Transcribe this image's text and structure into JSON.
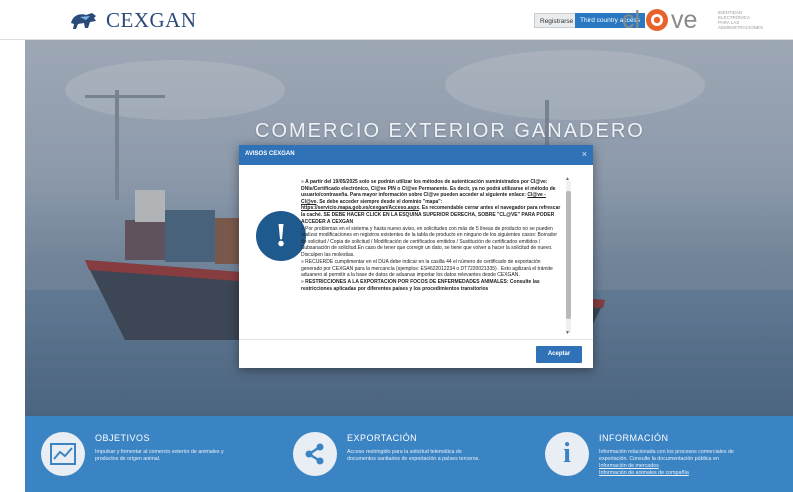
{
  "header": {
    "logo_text": "CEXGAN",
    "register_button": "Registrarse",
    "third_country_button": "Third country access",
    "clave_logo": "cl@ve",
    "clave_subtitle": "IDENTIDAD ELECTRÓNICA PARA LAS ADMINISTRACIONES"
  },
  "hero": {
    "title": "COMERCIO EXTERIOR GANADERO"
  },
  "modal": {
    "title": "AVISOS CEXGAN",
    "close_label": "×",
    "accept_button": "Aceptar",
    "messages": [
      {
        "lead": "A partir del 19/05/2025 solo se podrán utilizar los métodos de autenticación suministrados por Cl@ve: DNIe/Certificado electrónico, Cl@ve PIN o Cl@ve Permanente. Es decir, ya no podrá utilizarse el método de usuario/contraseña. Para mayor información sobre Cl@ve pueden acceder al siguiente enlace:",
        "link1": "Cl@ve - Cl@ve",
        "mid": ". Se debe acceder siempre desde el dominio \"mapa\":",
        "link2": "https://servicio.mapa.gob.es/cexgan/Acceso.aspx",
        "tail": ". Es recomendable cerrar antes el navegador para refrescar la caché. SE DEBE HACER CLICK EN LA ESQUINA SUPERIOR DERECHA, SOBRE \"CL@VE\" PARA PODER ACCEDER A CEXGAN"
      },
      {
        "text": "Por problemas en el sistema y hasta nuevo aviso, en solicitudes con más de 5 líneas de producto no se pueden realizar modificaciones en registros existentes de la tabla de producto en ninguno de los siguientes casos: Borrador de solicitud / Copia de solicitud / Modificación de certificados emitidos / Sustitución de certificados emitidos / Subsanación de solicitud.En caso de tener que corregir un dato, se tiene que volver a hacer la solicitud de nuevo. Disculpen las molestias."
      },
      {
        "text": "RECUERDE cumplimentar en el DUA debe indicar en la casilla 44 el número de certificado de exportación generado por CEXGAN para la mercancía (ejemplos: ES4622012234 o DT7220021335) . Esto agilizará el trámite aduanero al permitir a la base de datos de aduanas importar los datos relevantes desde CEXGAN."
      },
      {
        "text": "RESTRICCIONES A LA EXPORTACION POR FOCOS DE ENFERMEDADES ANIMALES: Consulte las restricciones aplicadas por diferentes países y los procedimientos transitorios"
      }
    ]
  },
  "footer": {
    "columns": [
      {
        "title": "OBJETIVOS",
        "icon": "chart-trend-icon",
        "text_lines": [
          "Impulsar y fomentar al comercio exterior de animales y",
          "productos de origen animal."
        ]
      },
      {
        "title": "EXPORTACIÓN",
        "icon": "share-icon",
        "text_lines": [
          "Acceso restringido para la solicitud telemática de",
          "documentos sanitarios de exportación a países terceros."
        ]
      },
      {
        "title": "INFORMACIÓN",
        "icon": "info-icon",
        "text_lines": [
          "Información relacionada con los procesos comerciales de",
          "exportación. Consulte la documentación pública en"
        ],
        "links": [
          "Información de mercados",
          "Información de animales de compañía"
        ]
      }
    ]
  },
  "colors": {
    "brand_blue": "#2f72b8",
    "footer_blue": "#3b84c4",
    "clave_orange": "#e8632b"
  }
}
